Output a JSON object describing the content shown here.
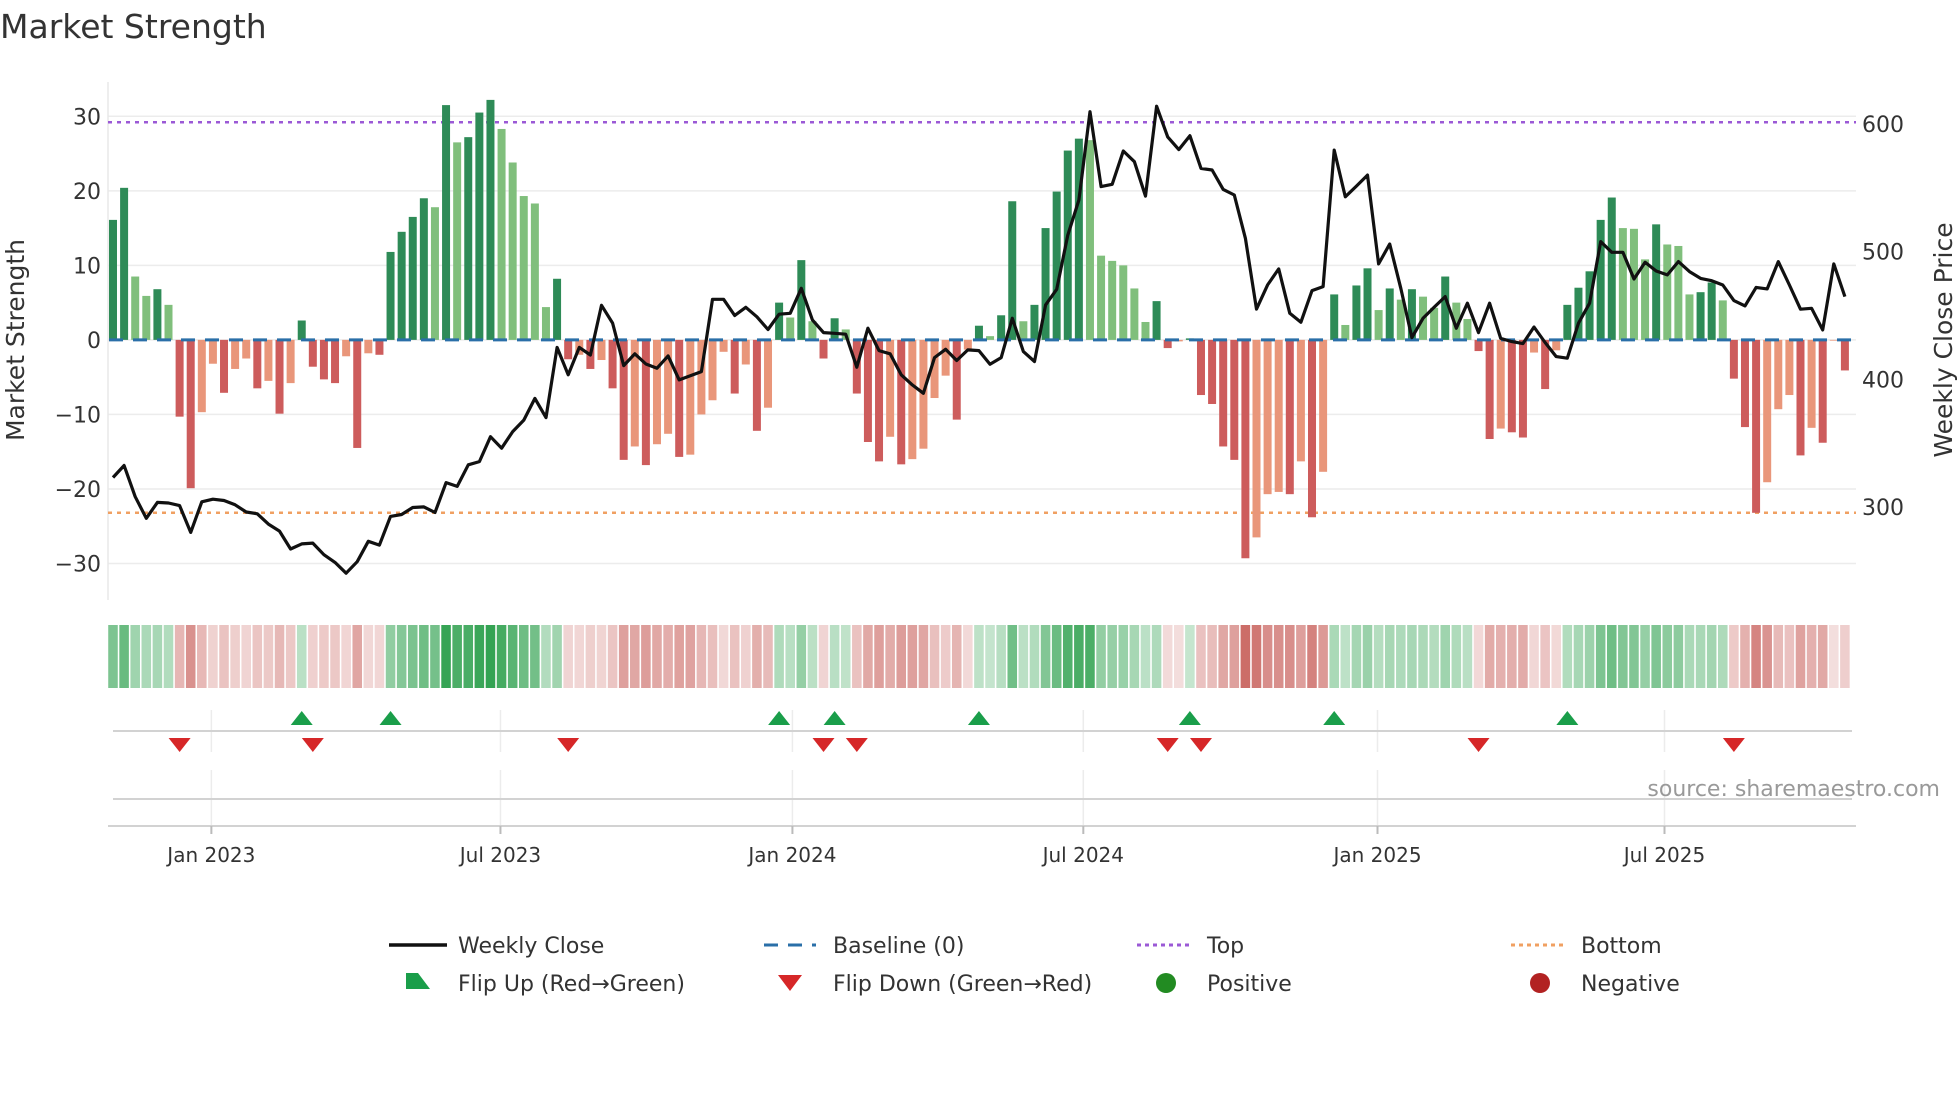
{
  "chart_data": {
    "type": "bar",
    "title": "Market Strength",
    "ylabel": "Market Strength",
    "y2label": "Weekly Close Price",
    "xlabel": "",
    "ylim": [
      -34.9,
      34.6
    ],
    "y2lim": [
      227,
      633
    ],
    "xlim": [
      -0.45,
      157.0
    ],
    "yticks": [
      -30,
      -20,
      -10,
      0,
      10,
      20,
      30
    ],
    "ytick_labels": [
      "−30",
      "−20",
      "−10",
      "0",
      "10",
      "20",
      "30"
    ],
    "y2ticks": [
      300,
      400,
      500,
      600
    ],
    "y2tick_labels": [
      "300",
      "400",
      "500",
      "600"
    ],
    "xticks": [
      {
        "label": "Jan 2023",
        "index": 8.86
      },
      {
        "label": "Jul 2023",
        "index": 34.9
      },
      {
        "label": "Jan 2024",
        "index": 61.2
      },
      {
        "label": "Jul 2024",
        "index": 87.4
      },
      {
        "label": "Jan 2025",
        "index": 113.9
      },
      {
        "label": "Jul 2025",
        "index": 139.75
      }
    ],
    "grid": true,
    "top_level": 29.2,
    "bottom_level": -23.2,
    "baseline": 0,
    "x_unit": "week index",
    "strength": [
      16.1,
      20.4,
      8.5,
      5.9,
      6.8,
      4.7,
      -10.3,
      -19.9,
      -9.7,
      -3.2,
      -7.1,
      -3.9,
      -2.5,
      -6.5,
      -5.5,
      -9.9,
      -5.8,
      2.6,
      -3.6,
      -5.3,
      -5.8,
      -2.2,
      -14.5,
      -1.8,
      -2.0,
      11.8,
      14.5,
      16.5,
      19.0,
      17.8,
      31.5,
      26.5,
      27.2,
      30.5,
      32.2,
      28.3,
      23.8,
      19.3,
      18.3,
      4.4,
      8.2,
      -2.6,
      -2.0,
      -3.9,
      -2.7,
      -6.5,
      -16.1,
      -14.3,
      -16.8,
      -14.0,
      -12.6,
      -15.7,
      -15.4,
      -10.0,
      -8.1,
      -1.6,
      -7.2,
      -3.3,
      -12.2,
      -9.1,
      5.0,
      3.0,
      10.7,
      2.5,
      -2.5,
      2.9,
      1.4,
      -7.2,
      -13.7,
      -16.3,
      -13.0,
      -16.7,
      -16.0,
      -14.6,
      -7.8,
      -4.8,
      -10.7,
      -1.3,
      1.9,
      0.5,
      3.3,
      18.6,
      2.5,
      4.7,
      15.0,
      19.9,
      25.4,
      27.0,
      26.8,
      11.3,
      10.6,
      10.0,
      6.9,
      2.4,
      5.2,
      -1.1,
      -0.2,
      0.2,
      -7.4,
      -8.6,
      -14.3,
      -16.1,
      -29.3,
      -26.5,
      -20.7,
      -20.4,
      -20.7,
      -16.3,
      -23.8,
      -17.7,
      6.1,
      2.0,
      7.3,
      9.6,
      4.0,
      6.9,
      5.4,
      6.8,
      5.8,
      4.3,
      8.5,
      5.0,
      2.8,
      -1.5,
      -13.3,
      -11.9,
      -12.4,
      -13.1,
      -1.7,
      -6.6,
      -1.4,
      4.7,
      7.0,
      9.2,
      16.1,
      19.1,
      15.0,
      14.9,
      10.8,
      15.5,
      12.8,
      12.6,
      6.1,
      6.4,
      7.7,
      5.3,
      -5.2,
      -11.7,
      -23.2,
      -19.1,
      -9.3,
      -7.4,
      -15.5,
      -11.8,
      -13.8,
      -0.1,
      -4.1
    ],
    "weekly_close": [
      323,
      332.4,
      308,
      291,
      303.5,
      303,
      301,
      280,
      304,
      306,
      305,
      301.6,
      296,
      294.6,
      286.5,
      281,
      267,
      271,
      271.6,
      262.5,
      256.5,
      248,
      257,
      273,
      270,
      292.5,
      294,
      299.5,
      300,
      295.6,
      319,
      316,
      333,
      335.5,
      355,
      346,
      359,
      368,
      385,
      370,
      425,
      403.5,
      425,
      419,
      458,
      444,
      410.7,
      420,
      412,
      408.7,
      418.3,
      399.5,
      402.7,
      406,
      462.7,
      462.7,
      450,
      456.4,
      449,
      439,
      451,
      451.7,
      471.3,
      446.5,
      436.6,
      436,
      435.3,
      409.5,
      440,
      422.5,
      420,
      403.5,
      395.6,
      389,
      417,
      423.5,
      414.7,
      423,
      422.5,
      411.8,
      417,
      447.8,
      421.7,
      413.9,
      458.3,
      470.5,
      513,
      540.5,
      609.7,
      551,
      552.8,
      578.9,
      570.5,
      543.6,
      614,
      590,
      580,
      590.9,
      565.3,
      564,
      548.8,
      544.4,
      510.5,
      455,
      474,
      486.5,
      451.7,
      444.7,
      469.5,
      472.6,
      579.6,
      543,
      551.4,
      560,
      490.4,
      506,
      471.3,
      432.7,
      447.8,
      456.4,
      464.8,
      440,
      459.6,
      436.6,
      459.6,
      432,
      429.5,
      428,
      441,
      428.8,
      417.8,
      416.5,
      444,
      459.6,
      507.9,
      499.5,
      499.5,
      478.6,
      491.7,
      484.9,
      481.8,
      492.2,
      484.4,
      479.1,
      477.3,
      473.9,
      461.7,
      457.5,
      472,
      470.8,
      492.2,
      473.9,
      454.9,
      455.6,
      438.7,
      490.4,
      464.8
    ],
    "legend": {
      "placement": "bottom",
      "entries": [
        {
          "label": "Weekly Close",
          "kind": "line"
        },
        {
          "label": "Baseline (0)",
          "kind": "dash"
        },
        {
          "label": "Top",
          "kind": "dot-purple"
        },
        {
          "label": "Bottom",
          "kind": "dot-orange"
        },
        {
          "label": "Flip Up (Red→Green)",
          "kind": "triangle-up"
        },
        {
          "label": "Flip Down (Green→Red)",
          "kind": "triangle-down"
        },
        {
          "label": "Positive",
          "kind": "circle-green"
        },
        {
          "label": "Negative",
          "kind": "circle-red"
        }
      ]
    },
    "annotation": "source: sharemaestro.com"
  },
  "colors": {
    "bar_pos_rising": "#2e8b57",
    "bar_pos_falling": "#80bf7c",
    "bar_neg_falling": "#cd5c5c",
    "bar_neg_rising": "#e9967a",
    "price_line": "#111111",
    "baseline": "#2a6fa8",
    "top": "#9b59d6",
    "bottom": "#f0a062",
    "flip_up": "#1a9e4a",
    "flip_down": "#d62728",
    "positive": "#228b22",
    "negative": "#b22222",
    "heat_green": "#34a353",
    "heat_red": "#c65a55",
    "grid": "#ececec"
  }
}
